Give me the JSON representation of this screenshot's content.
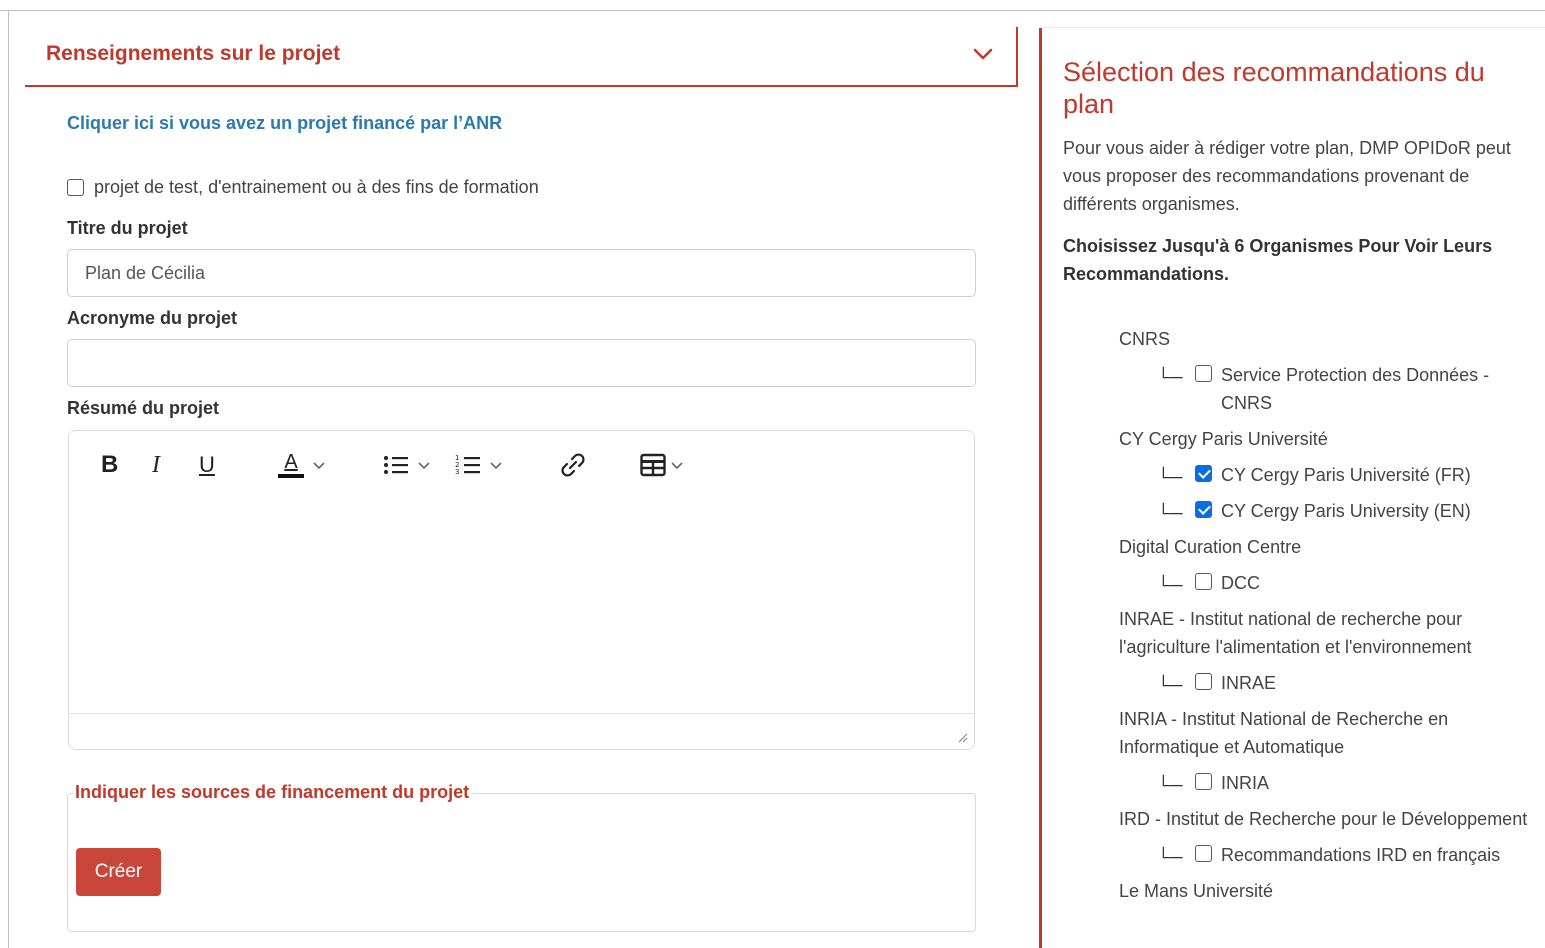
{
  "project_panel": {
    "title": "Renseignements sur le projet",
    "anr_link": "Cliquer ici si vous avez un projet financé par l’ANR",
    "test_checkbox_label": "projet de test, d'entrainement ou à des fins de formation",
    "test_checkbox_checked": false,
    "title_label": "Titre du projet",
    "title_value": "Plan de Cécilia",
    "acronym_label": "Acronyme du projet",
    "acronym_value": "",
    "summary_label": "Résumé du projet",
    "toolbar": {
      "bold": "B",
      "italic": "I",
      "underline": "U",
      "font_color": "A"
    },
    "funding_legend": "Indiquer les sources de financement du projet",
    "create_button": "Créer"
  },
  "recommendations": {
    "title": "Sélection des recommandations du plan",
    "description": "Pour vous aider à rédiger votre plan, DMP OPIDoR peut vous proposer des recommandations provenant de différents organismes.",
    "subtitle": "Choisissez Jusqu'à 6 Organismes Pour Voir Leurs Recommandations.",
    "tree_glyph": "└─",
    "orgs": [
      {
        "name": "CNRS",
        "children": [
          {
            "label": "Service Protection des Données - CNRS",
            "checked": false
          }
        ]
      },
      {
        "name": "CY Cergy Paris Université",
        "children": [
          {
            "label": "CY Cergy Paris Université (FR)",
            "checked": true
          },
          {
            "label": "CY Cergy Paris University (EN)",
            "checked": true
          }
        ]
      },
      {
        "name": "Digital Curation Centre",
        "children": [
          {
            "label": "DCC",
            "checked": false
          }
        ]
      },
      {
        "name": "INRAE - Institut national de recherche pour l'agriculture l'alimentation et l'environnement",
        "children": [
          {
            "label": "INRAE",
            "checked": false
          }
        ]
      },
      {
        "name": "INRIA - Institut National de Recherche en Informatique et Automatique",
        "children": [
          {
            "label": "INRIA",
            "checked": false
          }
        ]
      },
      {
        "name": "IRD - Institut de Recherche pour le Développement",
        "children": [
          {
            "label": "Recommandations IRD en français",
            "checked": false
          }
        ]
      },
      {
        "name": "Le Mans Université",
        "children": []
      }
    ]
  },
  "colors": {
    "accent": "#c0392b",
    "link": "#2a7ab0",
    "checkbox_checked": "#0b6ee0",
    "button": "#c9473a"
  }
}
